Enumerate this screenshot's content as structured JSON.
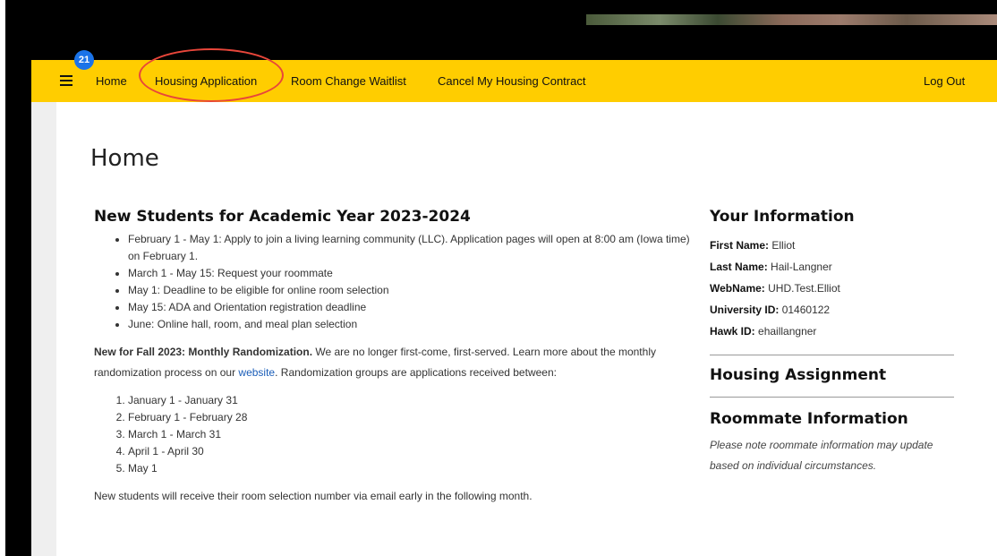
{
  "nav": {
    "badge_count": "21",
    "items": [
      "Home",
      "Housing Application",
      "Room Change Waitlist",
      "Cancel My Housing Contract"
    ],
    "logout": "Log Out"
  },
  "page_title": "Home",
  "main": {
    "heading": "New Students for Academic Year 2023-2024",
    "bullets": [
      "February 1 - May 1: Apply to join a living learning community (LLC). Application pages will open at 8:00 am (Iowa time) on February 1.",
      "March 1 - May 15: Request your roommate",
      "May 1: Deadline to be eligible for online room selection",
      "May 15: ADA and Orientation registration deadline",
      "June: Online hall, room, and meal plan selection"
    ],
    "para_bold": "New for Fall 2023: Monthly Randomization.",
    "para_text1": " We are no longer first-come, first-served. Learn more about the monthly randomization process on our ",
    "para_link": "website",
    "para_text2": ". Randomization groups are applications received between:",
    "groups": [
      "January 1 - January 31",
      "February 1 - February 28",
      "March 1 - March 31",
      "April 1 - April 30",
      "May 1"
    ],
    "closing": "New students will receive their room selection number via email early in the following month."
  },
  "side": {
    "heading": "Your Information",
    "fields": [
      {
        "label": "First Name:",
        "value": "Elliot"
      },
      {
        "label": "Last Name:",
        "value": "Hail-Langner"
      },
      {
        "label": "WebName:",
        "value": "UHD.Test.Elliot"
      },
      {
        "label": "University ID:",
        "value": "01460122"
      },
      {
        "label": "Hawk ID:",
        "value": "ehaillangner"
      }
    ],
    "housing_heading": "Housing Assignment",
    "roommate_heading": "Roommate Information",
    "roommate_note": "Please note roommate information may update based on individual circumstances."
  }
}
